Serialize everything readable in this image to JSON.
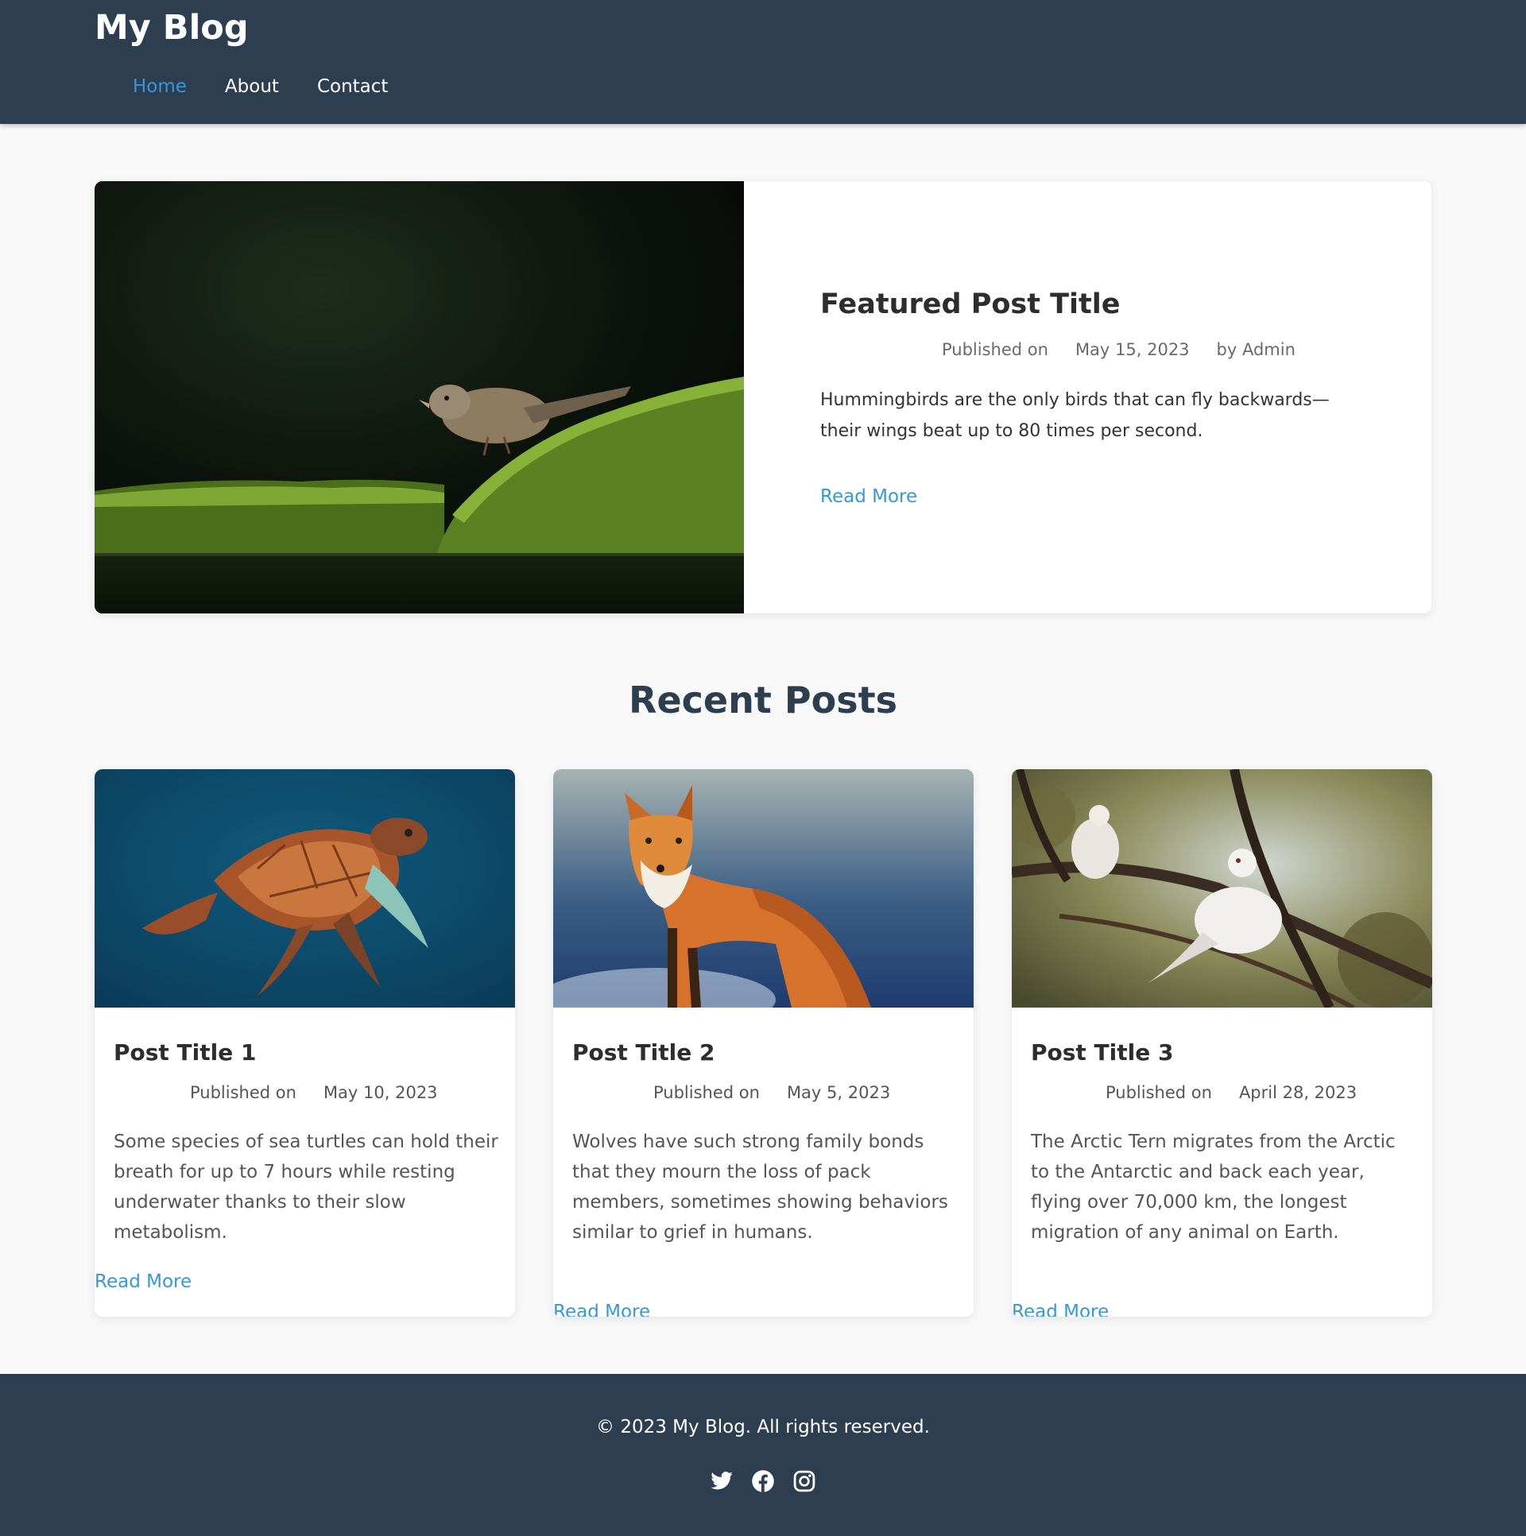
{
  "site": {
    "title": "My Blog"
  },
  "nav": [
    {
      "label": "Home",
      "active": true
    },
    {
      "label": "About",
      "active": false
    },
    {
      "label": "Contact",
      "active": false
    }
  ],
  "featured": {
    "title": "Featured Post Title",
    "published_label": "Published on",
    "date": "May 15, 2023",
    "author": "by Admin",
    "excerpt": "Hummingbirds are the only birds that can fly backwards—their wings beat up to 80 times per second.",
    "read_more": "Read More",
    "image": "sparrow-on-moss-photo"
  },
  "recent": {
    "heading": "Recent Posts",
    "posts": [
      {
        "title": "Post Title 1",
        "published_label": "Published on",
        "date": "May 10, 2023",
        "excerpt": "Some species of sea turtles can hold their breath for up to 7 hours while resting underwater thanks to their slow metabolism.",
        "read_more": "Read More",
        "image": "sea-turtle-photo"
      },
      {
        "title": "Post Title 2",
        "published_label": "Published on",
        "date": "May 5, 2023",
        "excerpt": "Wolves have such strong family bonds that they mourn the loss of pack members, sometimes showing behaviors similar to grief in humans.",
        "read_more": "Read More",
        "image": "red-fox-photo"
      },
      {
        "title": "Post Title 3",
        "published_label": "Published on",
        "date": "April 28, 2023",
        "excerpt": "The Arctic Tern migrates from the Arctic to the Antarctic and back each year, flying over 70,000 km, the longest migration of any animal on Earth.",
        "read_more": "Read More",
        "image": "white-doves-photo"
      }
    ]
  },
  "footer": {
    "copyright": "© 2023 My Blog. All rights reserved.",
    "socials": [
      "twitter-icon",
      "facebook-icon",
      "instagram-icon"
    ]
  },
  "colors": {
    "header_bg": "#2c3e50",
    "accent": "#3498db",
    "page_bg": "#f8f8f8",
    "heading": "#2c3e50"
  }
}
